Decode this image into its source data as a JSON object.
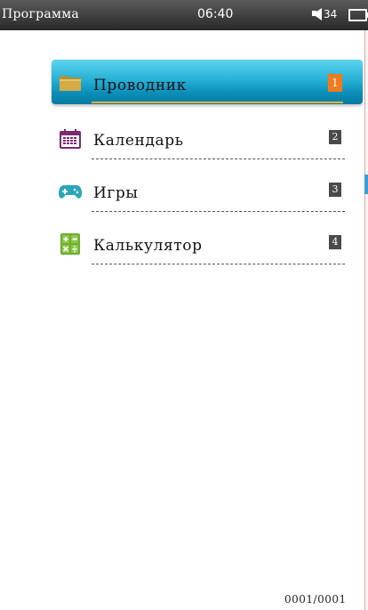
{
  "statusbar": {
    "title": "Программа",
    "time": "06:40",
    "volume": "34"
  },
  "menu": {
    "items": [
      {
        "label": "Проводник",
        "number": "1",
        "icon": "folder-icon",
        "selected": true
      },
      {
        "label": "Календарь",
        "number": "2",
        "icon": "calendar-icon",
        "selected": false
      },
      {
        "label": "Игры",
        "number": "3",
        "icon": "gamepad-icon",
        "selected": false
      },
      {
        "label": "Калькулятор",
        "number": "4",
        "icon": "calculator-icon",
        "selected": false
      }
    ]
  },
  "pager": "0001/0001",
  "colors": {
    "selected_top": "#5ed4ee",
    "selected_bottom": "#07799f",
    "selected_number": "#f07b1f",
    "number_badge": "#4a4a4a",
    "scroll_thumb": "#3d9fd6"
  }
}
